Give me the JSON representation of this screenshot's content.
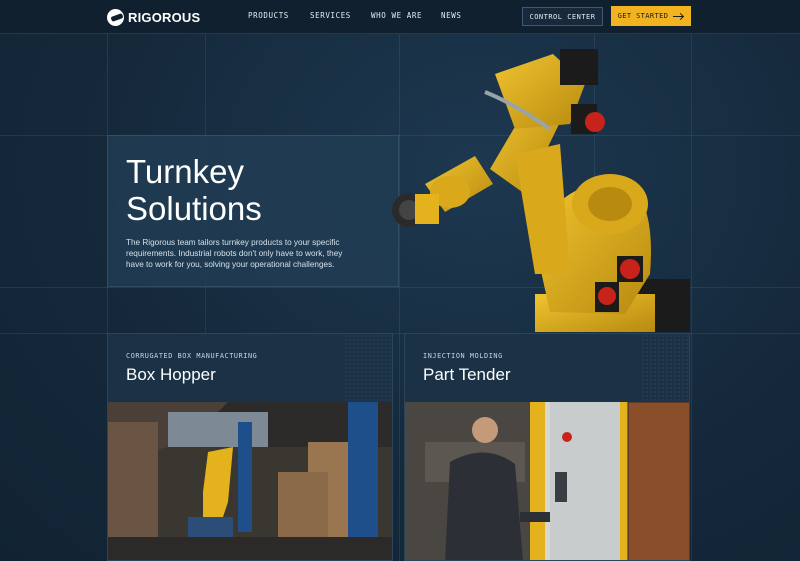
{
  "brand": {
    "name": "RIGOROUS",
    "logo_icon": "rigorous-logo-icon"
  },
  "nav": {
    "items": [
      {
        "label": "PRODUCTS"
      },
      {
        "label": "SERVICES"
      },
      {
        "label": "WHO WE ARE"
      },
      {
        "label": "NEWS"
      }
    ],
    "control_center_label": "CONTROL CENTER",
    "get_started_label": "GET STARTED"
  },
  "hero": {
    "title": "Turnkey Solutions",
    "body": "The Rigorous team tailors turnkey products to your specific requirements. Industrial robots don't only have to work, they have to work for you, solving your operational challenges."
  },
  "cards": [
    {
      "kicker": "CORRUGATED BOX MANUFACTURING",
      "title": "Box Hopper"
    },
    {
      "kicker": "INJECTION MOLDING",
      "title": "Part Tender"
    }
  ],
  "colors": {
    "accent": "#f2b321",
    "background": "#13283a",
    "robot_yellow": "#e3b21d"
  }
}
